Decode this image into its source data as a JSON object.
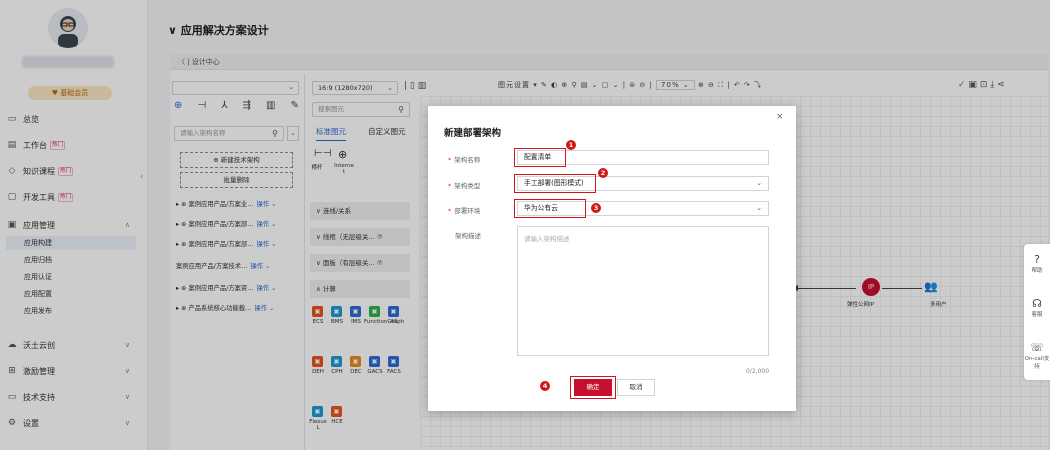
{
  "sidebar": {
    "member_badge": "基础会员",
    "items": [
      {
        "label": "总览",
        "icon": "overview-icon",
        "glyph": "▭"
      },
      {
        "label": "工作台",
        "icon": "workbench-icon",
        "glyph": "▤",
        "badge": "热门"
      },
      {
        "label": "知识课程",
        "icon": "knowledge-icon",
        "glyph": "◇",
        "badge": "热门"
      },
      {
        "label": "开发工具",
        "icon": "devtools-icon",
        "glyph": "▢",
        "badge": "热门"
      },
      {
        "label": "应用管理",
        "icon": "app-manage-icon",
        "glyph": "▣"
      },
      {
        "label": "沃土云创",
        "icon": "cloud-icon",
        "glyph": "☁"
      },
      {
        "label": "激励管理",
        "icon": "incentive-icon",
        "glyph": "⊞"
      },
      {
        "label": "技术支持",
        "icon": "support-icon",
        "glyph": "▭"
      },
      {
        "label": "设置",
        "icon": "settings-icon",
        "glyph": "⚙"
      }
    ],
    "sub_items": [
      "应用构建",
      "应用归档",
      "应用认证",
      "应用配置",
      "应用发布"
    ]
  },
  "page_title": "应用解决方案设计",
  "breadcrumb": "〈 | 设计中心",
  "arch_panel": {
    "search_placeholder": "请输入架构名称",
    "new_button": "⊕ 新建技术架构",
    "batch_delete": "批量删除",
    "tree": [
      {
        "label": "▸  ⊕ 案例应用产品/方案业…",
        "op": "操作 ⌄"
      },
      {
        "label": "▸  ⊕ 案例应用产品/方案部…",
        "op": "操作 ⌄"
      },
      {
        "label": "▸  ⊕ 案例应用产品/方案部…",
        "op": "操作 ⌄"
      },
      {
        "label": "     案例应用产品/方案技术…",
        "op": "操作 ⌄"
      },
      {
        "label": "▸  ⊕ 案例应用产品/方案资…",
        "op": "操作 ⌄"
      },
      {
        "label": "▸  ⊕ 产品系统核心功能載…",
        "op": "操作 ⌄"
      }
    ]
  },
  "elem_panel": {
    "size_value": "16:9 (1280x720)",
    "search_placeholder": "搜索图元",
    "tab_std": "标准图元",
    "tab_custom": "自定义图元",
    "line_labels": [
      "横杆",
      "Interne t"
    ],
    "sections": [
      "∨  连线/关系",
      "∨  线框（无层级关… ⑦",
      "∨  面板（有层级关… ⑦",
      "∧  计算"
    ],
    "services_row1": [
      {
        "name": "ECS",
        "color": "#e8541c"
      },
      {
        "name": "BMS",
        "color": "#1a9bd7"
      },
      {
        "name": "IMS",
        "color": "#2b6bd8"
      },
      {
        "name": "FunctionGraph",
        "color": "#2cb34a"
      },
      {
        "name": "AS",
        "color": "#2b6bd8"
      }
    ],
    "services_row2": [
      {
        "name": "DEH",
        "color": "#e8541c"
      },
      {
        "name": "CPH",
        "color": "#1a9bd7"
      },
      {
        "name": "DEC",
        "color": "#e88a1c"
      },
      {
        "name": "GACS",
        "color": "#2b6bd8"
      },
      {
        "name": "FACS",
        "color": "#2b6bd8"
      }
    ],
    "services_row3": [
      {
        "name": "Flexus L",
        "color": "#1a9bd7"
      },
      {
        "name": "HCE",
        "color": "#e8541c"
      }
    ]
  },
  "canvas_toolbar": {
    "text": "图元设置 ▾  ✎  ◐  ⊕  ⚲  ▤ ⌄  ▢ ⌄  |  ⊜  ⊝  |",
    "zoom": "70%",
    "right": "⊕ ⊖ ⛶ | ↶ ↷ ⤵"
  },
  "canvas": {
    "eip_text": "IP",
    "eip_label": "弹性公网IP",
    "users_label": "多用户"
  },
  "help_bar": [
    {
      "label": "帮助",
      "icon": "help-icon",
      "glyph": "?"
    },
    {
      "label": "客服",
      "icon": "service-icon",
      "glyph": "☊"
    },
    {
      "label": "On-call支持",
      "icon": "oncall-icon",
      "glyph": "☏"
    }
  ],
  "modal": {
    "title": "新建部署架构",
    "close": "×",
    "fields": {
      "name_label": "架构名称",
      "name_value": "配置清单",
      "type_label": "架构类型",
      "type_value": "手工部署(图形模式)",
      "env_label": "部署环境",
      "env_value": "华为公有云",
      "desc_label": "架构描述",
      "desc_placeholder": "请输入架构描述",
      "desc_count": "0/2,000"
    },
    "ok": "确定",
    "cancel": "取消",
    "step_markers": [
      "1",
      "2",
      "3",
      "4"
    ]
  },
  "colors": {
    "accent": "#c8102e",
    "link": "#2b6bd8",
    "annotation": "#d41616"
  }
}
